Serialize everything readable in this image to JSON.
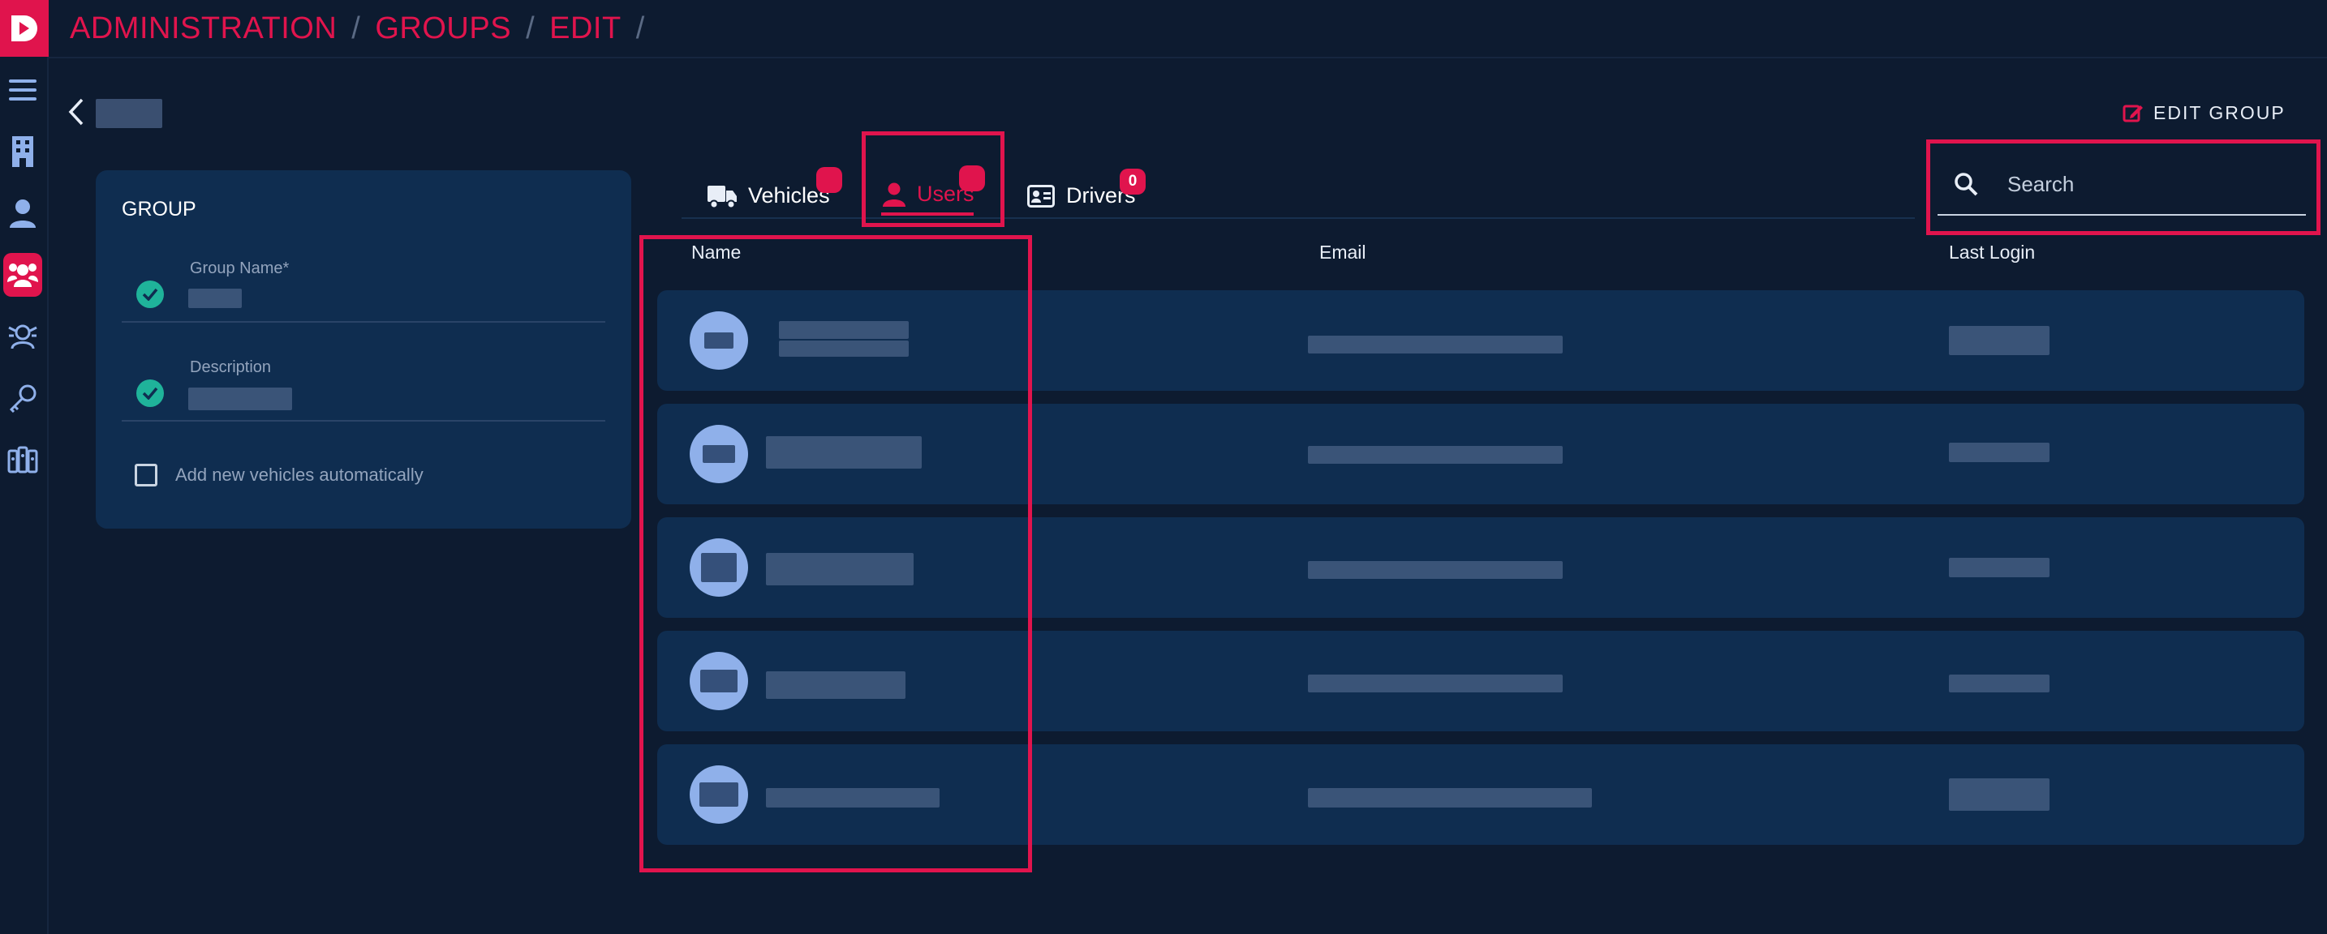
{
  "breadcrumb": {
    "items": [
      "ADMINISTRATION",
      "GROUPS",
      "EDIT"
    ],
    "separator": "/"
  },
  "header": {
    "edit_group_label": "EDIT GROUP"
  },
  "group_card": {
    "title": "GROUP",
    "fields": [
      {
        "label": "Group Name*"
      },
      {
        "label": "Description"
      }
    ],
    "auto_add_label": "Add new vehicles automatically"
  },
  "tabs": [
    {
      "label": "Vehicles",
      "icon": "truck-icon"
    },
    {
      "label": "Users",
      "icon": "user-icon"
    },
    {
      "label": "Drivers",
      "icon": "id-card-icon",
      "badge": "0"
    }
  ],
  "search": {
    "placeholder": "Search"
  },
  "table": {
    "columns": [
      "Name",
      "Email",
      "Last Login"
    ]
  },
  "sidebar": {
    "items": [
      "menu-icon",
      "building-icon",
      "user-icon",
      "users-group-icon",
      "drivers-icon",
      "key-icon",
      "fleet-icon"
    ]
  },
  "colors": {
    "accent": "#e0144d",
    "background": "#0d1b30",
    "card": "#0f2d50",
    "success": "#1fb39a",
    "avatar": "#8fb0ea"
  }
}
